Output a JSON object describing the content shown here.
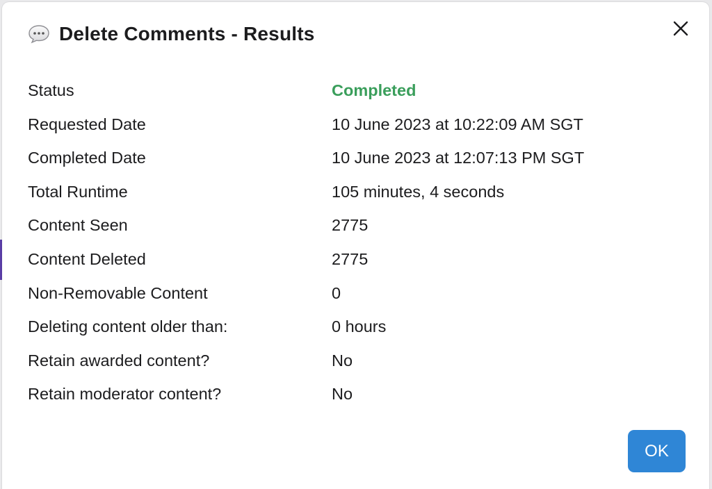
{
  "dialog": {
    "title": "Delete Comments - Results",
    "title_icon": "speech-bubble-icon",
    "close_icon": "close-icon",
    "rows": [
      {
        "label": "Status",
        "value": "Completed"
      },
      {
        "label": "Requested Date",
        "value": "10 June 2023 at 10:22:09 AM SGT"
      },
      {
        "label": "Completed Date",
        "value": "10 June 2023 at 12:07:13 PM SGT"
      },
      {
        "label": "Total Runtime",
        "value": "105 minutes, 4 seconds"
      },
      {
        "label": "Content Seen",
        "value": "2775"
      },
      {
        "label": "Content Deleted",
        "value": "2775"
      },
      {
        "label": "Non-Removable Content",
        "value": "0"
      },
      {
        "label": "Deleting content older than:",
        "value": "0 hours"
      },
      {
        "label": "Retain awarded content?",
        "value": "No"
      },
      {
        "label": "Retain moderator content?",
        "value": "No"
      }
    ],
    "ok_label": "OK"
  },
  "colors": {
    "status_completed": "#3a9e5b",
    "ok_button": "#2f86d6",
    "text": "#1c1c1e"
  }
}
